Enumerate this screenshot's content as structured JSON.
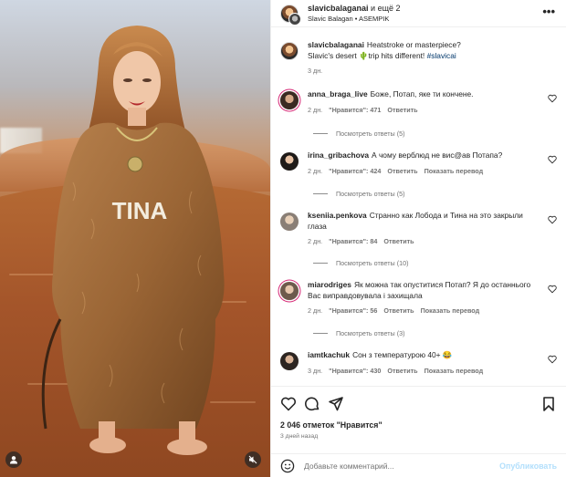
{
  "media": {
    "overlay_text": "TINA",
    "user_tag_icon": "user-icon",
    "mute_icon": "speaker-muted-icon"
  },
  "header": {
    "title_user": "slavicbalaganai",
    "title_extra": " и ещё 2",
    "subtitle": "Slavic Balagan • ASEMPIK",
    "more_icon": "more-horizontal-icon",
    "more_glyph": "•••"
  },
  "caption": {
    "user": "slavicbalaganai",
    "text_line1": "Heatstroke or masterpiece?",
    "text_line2_pre": "Slavic's desert ",
    "emoji": "🌵",
    "text_line2_post": "trip hits different! ",
    "hashtag": "#slavicai",
    "time": "3 дн."
  },
  "comments": [
    {
      "user": "anna_braga_live",
      "text": "Боже, Потап, яке ти кончене.",
      "time": "2 дн.",
      "likes": "\"Нравится\": 471",
      "reply": "Ответить",
      "translate": "",
      "view_replies": "Посмотреть ответы (5)"
    },
    {
      "user": "irina_gribachova",
      "text": "А чому верблюд не вис@ав Потапа?",
      "time": "2 дн.",
      "likes": "\"Нравится\": 424",
      "reply": "Ответить",
      "translate": "Показать перевод",
      "view_replies": "Посмотреть ответы (5)"
    },
    {
      "user": "kseniia.penkova",
      "text": "Странно как Лобода и Тина на это закрыли глаза",
      "time": "2 дн.",
      "likes": "\"Нравится\": 84",
      "reply": "Ответить",
      "translate": "",
      "view_replies": "Посмотреть ответы (10)"
    },
    {
      "user": "miarodriges",
      "text": "Як можна так опуститися Потап? Я до останнього Вас виправдовувала і захищала",
      "time": "2 дн.",
      "likes": "\"Нравится\": 56",
      "reply": "Ответить",
      "translate": "Показать перевод",
      "view_replies": "Посмотреть ответы (3)"
    },
    {
      "user": "iamtkachuk",
      "text": "Сон з температурою 40+",
      "emoji": "😂",
      "time": "3 дн.",
      "likes": "\"Нравится\": 430",
      "reply": "Ответить",
      "translate": "Показать перевод",
      "view_replies": ""
    }
  ],
  "actions": {
    "like_icon": "heart-icon",
    "comment_icon": "comment-icon",
    "share_icon": "send-icon",
    "save_icon": "bookmark-icon",
    "likes_count": "2 046 отметок \"Нравится\"",
    "time_ago": "3 дней назад"
  },
  "add_comment": {
    "emoji_icon": "smiley-icon",
    "placeholder": "Добавьте комментарий...",
    "publish_label": "Опубликовать"
  },
  "colors": {
    "link_blue": "#00376b",
    "publish_disabled": "#b2dffc",
    "story_ring": "#d62976",
    "muted_text": "#737373"
  }
}
